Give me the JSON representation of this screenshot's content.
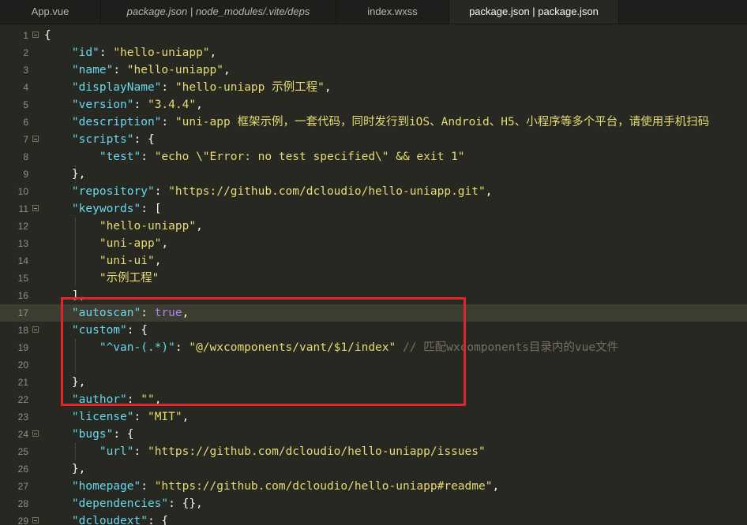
{
  "tabs": [
    {
      "label": "App.vue",
      "italic": false,
      "active": false
    },
    {
      "label": "package.json | node_modules/.vite/deps",
      "italic": true,
      "active": false
    },
    {
      "label": "index.wxss",
      "italic": false,
      "active": false
    },
    {
      "label": "package.json | package.json",
      "italic": false,
      "active": true
    }
  ],
  "editor": {
    "highlighted_line": 17,
    "colors": {
      "background": "#272822",
      "key": "#66d9ef",
      "string": "#e6db74",
      "constant": "#ae81ff",
      "comment": "#75715e",
      "annotation_box": "#e0262d"
    },
    "lines": [
      {
        "n": "1",
        "fold": true,
        "segs": [
          [
            "p",
            "{"
          ]
        ]
      },
      {
        "n": "2",
        "segs": [
          [
            "p",
            "    "
          ],
          [
            "k",
            "\"id\""
          ],
          [
            "p",
            ": "
          ],
          [
            "s",
            "\"hello-uniapp\""
          ],
          [
            "p",
            ","
          ]
        ]
      },
      {
        "n": "3",
        "segs": [
          [
            "p",
            "    "
          ],
          [
            "k",
            "\"name\""
          ],
          [
            "p",
            ": "
          ],
          [
            "s",
            "\"hello-uniapp\""
          ],
          [
            "p",
            ","
          ]
        ]
      },
      {
        "n": "4",
        "segs": [
          [
            "p",
            "    "
          ],
          [
            "k",
            "\"displayName\""
          ],
          [
            "p",
            ": "
          ],
          [
            "s",
            "\"hello-uniapp 示例工程\""
          ],
          [
            "p",
            ","
          ]
        ]
      },
      {
        "n": "5",
        "segs": [
          [
            "p",
            "    "
          ],
          [
            "k",
            "\"version\""
          ],
          [
            "p",
            ": "
          ],
          [
            "s",
            "\"3.4.4\""
          ],
          [
            "p",
            ","
          ]
        ]
      },
      {
        "n": "6",
        "segs": [
          [
            "p",
            "    "
          ],
          [
            "k",
            "\"description\""
          ],
          [
            "p",
            ": "
          ],
          [
            "s",
            "\"uni-app 框架示例，一套代码，同时发行到iOS、Android、H5、小程序等多个平台，请使用手机扫码"
          ]
        ]
      },
      {
        "n": "7",
        "fold": true,
        "segs": [
          [
            "p",
            "    "
          ],
          [
            "k",
            "\"scripts\""
          ],
          [
            "p",
            ": {"
          ]
        ]
      },
      {
        "n": "8",
        "segs": [
          [
            "p",
            "        "
          ],
          [
            "k",
            "\"test\""
          ],
          [
            "p",
            ": "
          ],
          [
            "s",
            "\"echo \\\"Error: no test specified\\\" && exit 1\""
          ]
        ]
      },
      {
        "n": "9",
        "segs": [
          [
            "p",
            "    },"
          ]
        ]
      },
      {
        "n": "10",
        "segs": [
          [
            "p",
            "    "
          ],
          [
            "k",
            "\"repository\""
          ],
          [
            "p",
            ": "
          ],
          [
            "s",
            "\"https://github.com/dcloudio/hello-uniapp.git\""
          ],
          [
            "p",
            ","
          ]
        ]
      },
      {
        "n": "11",
        "fold": true,
        "segs": [
          [
            "p",
            "    "
          ],
          [
            "k",
            "\"keywords\""
          ],
          [
            "p",
            ": ["
          ]
        ]
      },
      {
        "n": "12",
        "segs": [
          [
            "p",
            "        "
          ],
          [
            "s",
            "\"hello-uniapp\""
          ],
          [
            "p",
            ","
          ]
        ]
      },
      {
        "n": "13",
        "segs": [
          [
            "p",
            "        "
          ],
          [
            "s",
            "\"uni-app\""
          ],
          [
            "p",
            ","
          ]
        ]
      },
      {
        "n": "14",
        "segs": [
          [
            "p",
            "        "
          ],
          [
            "s",
            "\"uni-ui\""
          ],
          [
            "p",
            ","
          ]
        ]
      },
      {
        "n": "15",
        "segs": [
          [
            "p",
            "        "
          ],
          [
            "s",
            "\"示例工程\""
          ]
        ]
      },
      {
        "n": "16",
        "segs": [
          [
            "p",
            "    ],"
          ]
        ]
      },
      {
        "n": "17",
        "segs": [
          [
            "p",
            "    "
          ],
          [
            "k",
            "\"autoscan\""
          ],
          [
            "p",
            ": "
          ],
          [
            "v",
            "true"
          ],
          [
            "p",
            ","
          ]
        ]
      },
      {
        "n": "18",
        "fold": true,
        "segs": [
          [
            "p",
            "    "
          ],
          [
            "k",
            "\"custom\""
          ],
          [
            "p",
            ": {"
          ]
        ]
      },
      {
        "n": "19",
        "segs": [
          [
            "p",
            "        "
          ],
          [
            "k",
            "\"^van-(.*)\""
          ],
          [
            "p",
            ": "
          ],
          [
            "s",
            "\"@/wxcomponents/vant/$1/index\""
          ],
          [
            "p",
            " "
          ],
          [
            "c",
            "// 匹配wxcomponents目录内的vue文件"
          ]
        ]
      },
      {
        "n": "20",
        "segs": []
      },
      {
        "n": "21",
        "segs": [
          [
            "p",
            "    },"
          ]
        ]
      },
      {
        "n": "22",
        "segs": [
          [
            "p",
            "    "
          ],
          [
            "k",
            "\"author\""
          ],
          [
            "p",
            ": "
          ],
          [
            "s",
            "\"\""
          ],
          [
            "p",
            ","
          ]
        ]
      },
      {
        "n": "23",
        "segs": [
          [
            "p",
            "    "
          ],
          [
            "k",
            "\"license\""
          ],
          [
            "p",
            ": "
          ],
          [
            "s",
            "\"MIT\""
          ],
          [
            "p",
            ","
          ]
        ]
      },
      {
        "n": "24",
        "fold": true,
        "segs": [
          [
            "p",
            "    "
          ],
          [
            "k",
            "\"bugs\""
          ],
          [
            "p",
            ": {"
          ]
        ]
      },
      {
        "n": "25",
        "segs": [
          [
            "p",
            "        "
          ],
          [
            "k",
            "\"url\""
          ],
          [
            "p",
            ": "
          ],
          [
            "s",
            "\"https://github.com/dcloudio/hello-uniapp/issues\""
          ]
        ]
      },
      {
        "n": "26",
        "segs": [
          [
            "p",
            "    },"
          ]
        ]
      },
      {
        "n": "27",
        "segs": [
          [
            "p",
            "    "
          ],
          [
            "k",
            "\"homepage\""
          ],
          [
            "p",
            ": "
          ],
          [
            "s",
            "\"https://github.com/dcloudio/hello-uniapp#readme\""
          ],
          [
            "p",
            ","
          ]
        ]
      },
      {
        "n": "28",
        "segs": [
          [
            "p",
            "    "
          ],
          [
            "k",
            "\"dependencies\""
          ],
          [
            "p",
            ": {},"
          ]
        ]
      },
      {
        "n": "29",
        "fold": true,
        "segs": [
          [
            "p",
            "    "
          ],
          [
            "k",
            "\"dcloudext\""
          ],
          [
            "p",
            ": {"
          ]
        ]
      }
    ]
  }
}
